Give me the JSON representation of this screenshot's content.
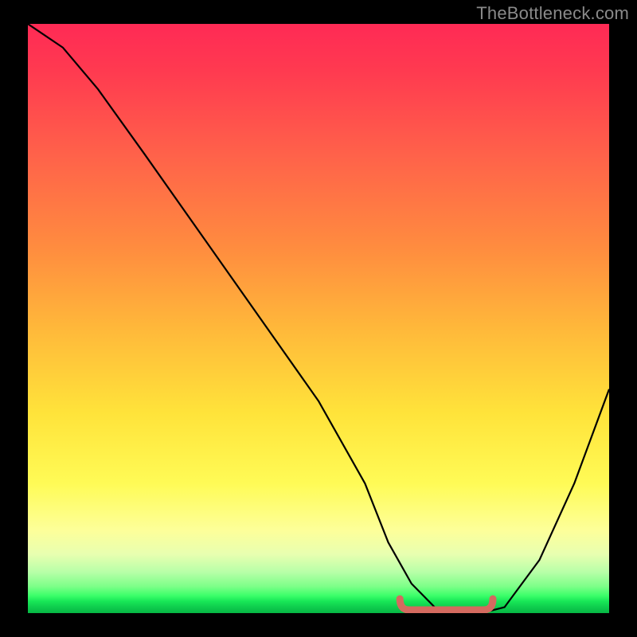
{
  "watermark": "TheBottleneck.com",
  "chart_data": {
    "type": "line",
    "title": "",
    "xlabel": "",
    "ylabel": "",
    "xlim": [
      0,
      100
    ],
    "ylim": [
      0,
      100
    ],
    "grid": false,
    "legend": false,
    "background": "vertical-gradient red→yellow→green",
    "series": [
      {
        "name": "curve",
        "color": "#000000",
        "x": [
          0,
          6,
          12,
          20,
          30,
          40,
          50,
          58,
          62,
          66,
          70,
          74,
          78,
          82,
          88,
          94,
          100
        ],
        "values": [
          100,
          96,
          89,
          78,
          64,
          50,
          36,
          22,
          12,
          5,
          1,
          0,
          0,
          1,
          9,
          22,
          38
        ]
      }
    ],
    "annotations": [
      {
        "name": "valley-highlight",
        "shape": "rounded-segment",
        "color": "#d46a5f",
        "x_range": [
          64,
          80
        ],
        "y": 0
      }
    ]
  }
}
